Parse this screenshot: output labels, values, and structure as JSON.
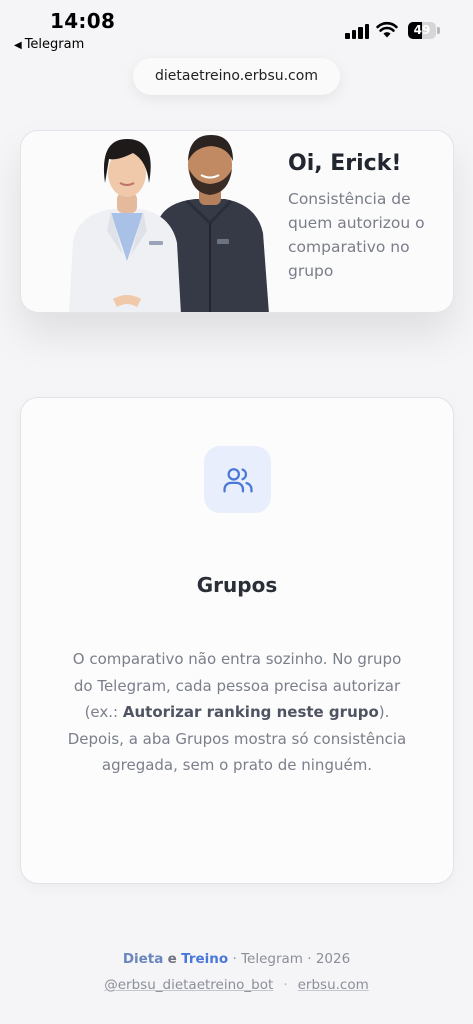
{
  "status_bar": {
    "time": "14:08",
    "back_label": "Telegram",
    "battery_level": "49",
    "battery_percent": 49
  },
  "browser": {
    "url": "dietaetreino.erbsu.com"
  },
  "hero": {
    "greeting": "Oi, Erick!",
    "subtitle": "Consistência de quem autorizou o comparativo no grupo"
  },
  "groups": {
    "icon": "users-icon",
    "title": "Grupos",
    "desc_part1": "O comparativo não entra sozinho. No grupo do Telegram, cada pessoa precisa autorizar (ex.: ",
    "desc_bold": "Autorizar ranking neste grupo",
    "desc_part2": "). Depois, a aba Grupos mostra só consistência agregada, sem o prato de ninguém."
  },
  "footer": {
    "brand_dieta": "Dieta",
    "brand_e": "e",
    "brand_treino": "Treino",
    "platform": "Telegram",
    "year": "2026",
    "bot_handle": "@erbsu_dietaetreino_bot",
    "site": "erbsu.com"
  },
  "colors": {
    "accent": "#4a78d8",
    "icon_bg": "#e8eefc",
    "text_muted": "#7b7f8a"
  }
}
